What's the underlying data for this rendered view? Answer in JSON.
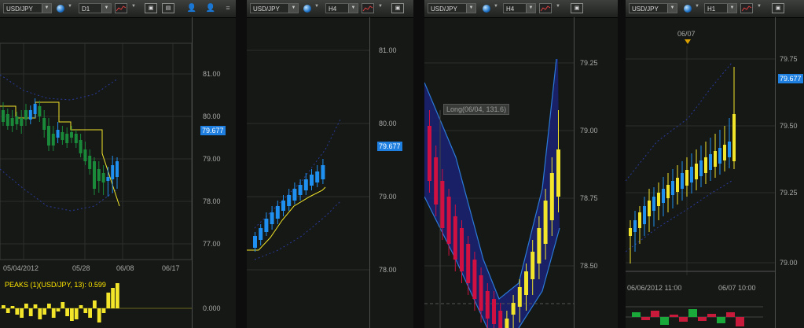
{
  "panels": [
    {
      "symbol": "USD/JPY",
      "timeframe": "D1",
      "price_labels": [
        "81.00",
        "80.00",
        "79.00",
        "78.00",
        "77.00"
      ],
      "current_price": "79.677",
      "date_labels": [
        "05/04/2012",
        "05/28",
        "06/08",
        "06/17"
      ],
      "indicator_label": "PEAKS (1)(USD/JPY, 13): 0.599",
      "indicator_value": "0.000"
    },
    {
      "symbol": "USD/JPY",
      "timeframe": "H4",
      "price_labels": [
        "81.00",
        "80.00",
        "79.00",
        "78.00"
      ],
      "current_price": "79.677"
    },
    {
      "symbol": "USD/JPY",
      "timeframe": "H4",
      "price_labels": [
        "79.25",
        "79.00",
        "78.75",
        "78.50"
      ],
      "tooltip": "Long(06/04, 131.6)"
    },
    {
      "symbol": "USD/JPY",
      "timeframe": "H1",
      "top_date": "06/07",
      "price_labels": [
        "79.75",
        "79.50",
        "79.25",
        "79.00"
      ],
      "current_price": "79.677",
      "date_labels": [
        "06/06/2012 11:00",
        "06/07 10:00"
      ]
    }
  ],
  "icons": {
    "globe": "globe-icon",
    "chart_type": "line-chart-icon",
    "template": "template-icon",
    "user": "user-icon",
    "menu": "menu-icon"
  },
  "colors": {
    "bull_blue": "#1f8ff0",
    "bear_green": "#1a8a3a",
    "bear_red": "#d01040",
    "bull_yellow": "#f2e52a",
    "channel": "#1a237a",
    "accent": "#1e7fe0"
  }
}
